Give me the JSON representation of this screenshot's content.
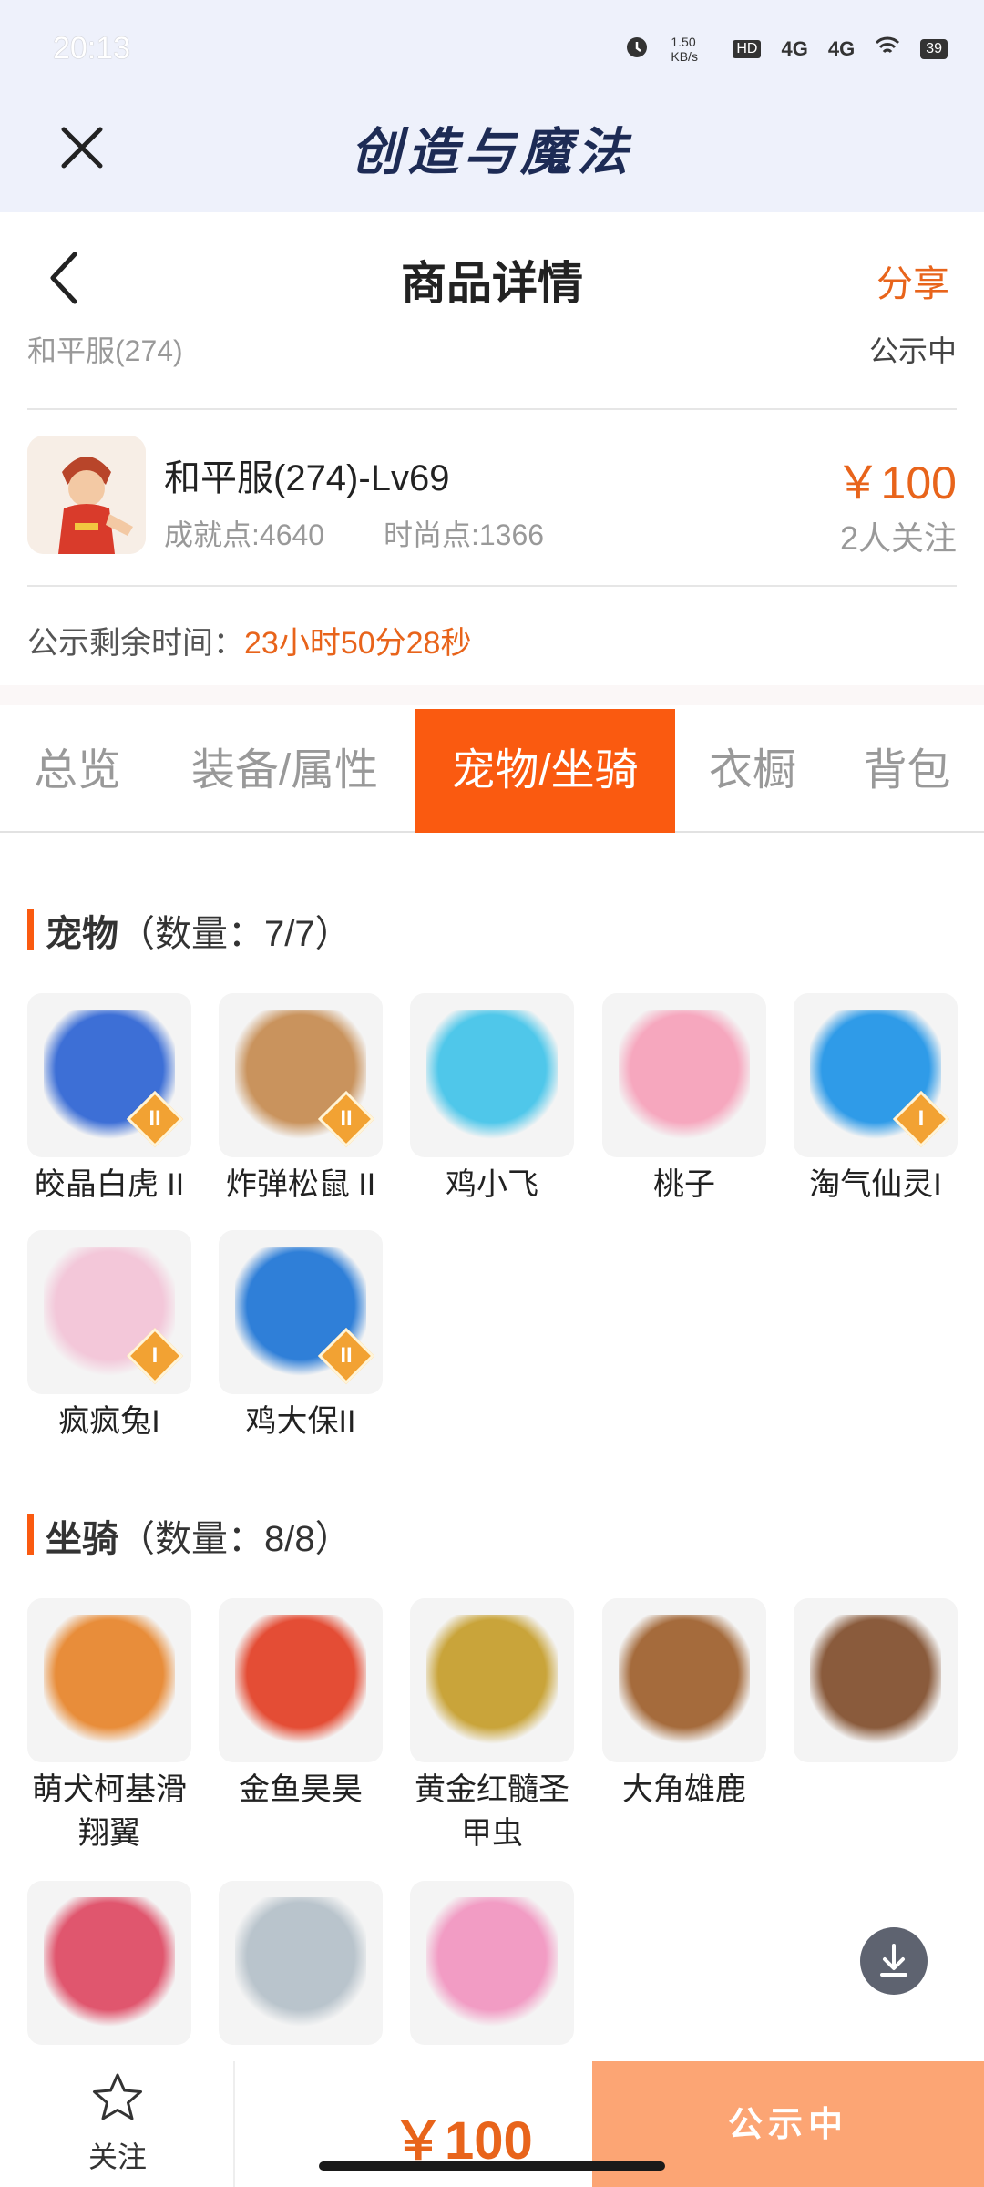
{
  "status_bar": {
    "time": "20:13",
    "net_speed": "1.50 KB/s",
    "hd": "HD",
    "signal_1": "4G",
    "signal_2": "4G",
    "battery": "39"
  },
  "app_bar": {
    "title": "创造与魔法"
  },
  "header": {
    "title": "商品详情",
    "share": "分享"
  },
  "server": {
    "name": "和平服(274)",
    "state": "公示中"
  },
  "item": {
    "name": "和平服(274)-Lv69",
    "achievement": "成就点:4640",
    "fashion": "时尚点:1366",
    "price": "￥100",
    "follows": "2人关注"
  },
  "remaining": {
    "label": "公示剩余时间：",
    "value": "23小时50分28秒"
  },
  "tabs": [
    {
      "label": "总览"
    },
    {
      "label": "装备/属性"
    },
    {
      "label": "宠物/坐骑"
    },
    {
      "label": "衣橱"
    },
    {
      "label": "背包"
    }
  ],
  "pets": {
    "title": "宠物",
    "count": "（数量：7/7）",
    "items": [
      {
        "name": "皎晶白虎 II",
        "badge": "II",
        "color": "#3d6fd6"
      },
      {
        "name": "炸弹松鼠 II",
        "badge": "II",
        "color": "#c9935d"
      },
      {
        "name": "鸡小飞",
        "badge": "",
        "color": "#4fc7ea"
      },
      {
        "name": "桃子",
        "badge": "",
        "color": "#f6a7be"
      },
      {
        "name": "淘气仙灵I",
        "badge": "I",
        "color": "#2f9be8"
      },
      {
        "name": "疯疯兔I",
        "badge": "I",
        "color": "#f3c7d9"
      },
      {
        "name": "鸡大保II",
        "badge": "II",
        "color": "#2f7fd8"
      }
    ]
  },
  "mounts": {
    "title": "坐骑",
    "count": "（数量：8/8）",
    "items": [
      {
        "name": "萌犬柯基滑翔翼",
        "color": "#e88d3a"
      },
      {
        "name": "金鱼昊昊",
        "color": "#e44d35"
      },
      {
        "name": "黄金红髓圣甲虫",
        "color": "#c9a43a"
      },
      {
        "name": "大角雄鹿",
        "color": "#a56b3c"
      },
      {
        "name": "",
        "color": "#8a5b3c"
      },
      {
        "name": "",
        "color": "#e0566e"
      },
      {
        "name": "",
        "color": "#b9c4cc"
      },
      {
        "name": "",
        "color": "#f29cc4"
      }
    ]
  },
  "bottom": {
    "follow": "关注",
    "price": "￥100",
    "action": "公示中"
  }
}
